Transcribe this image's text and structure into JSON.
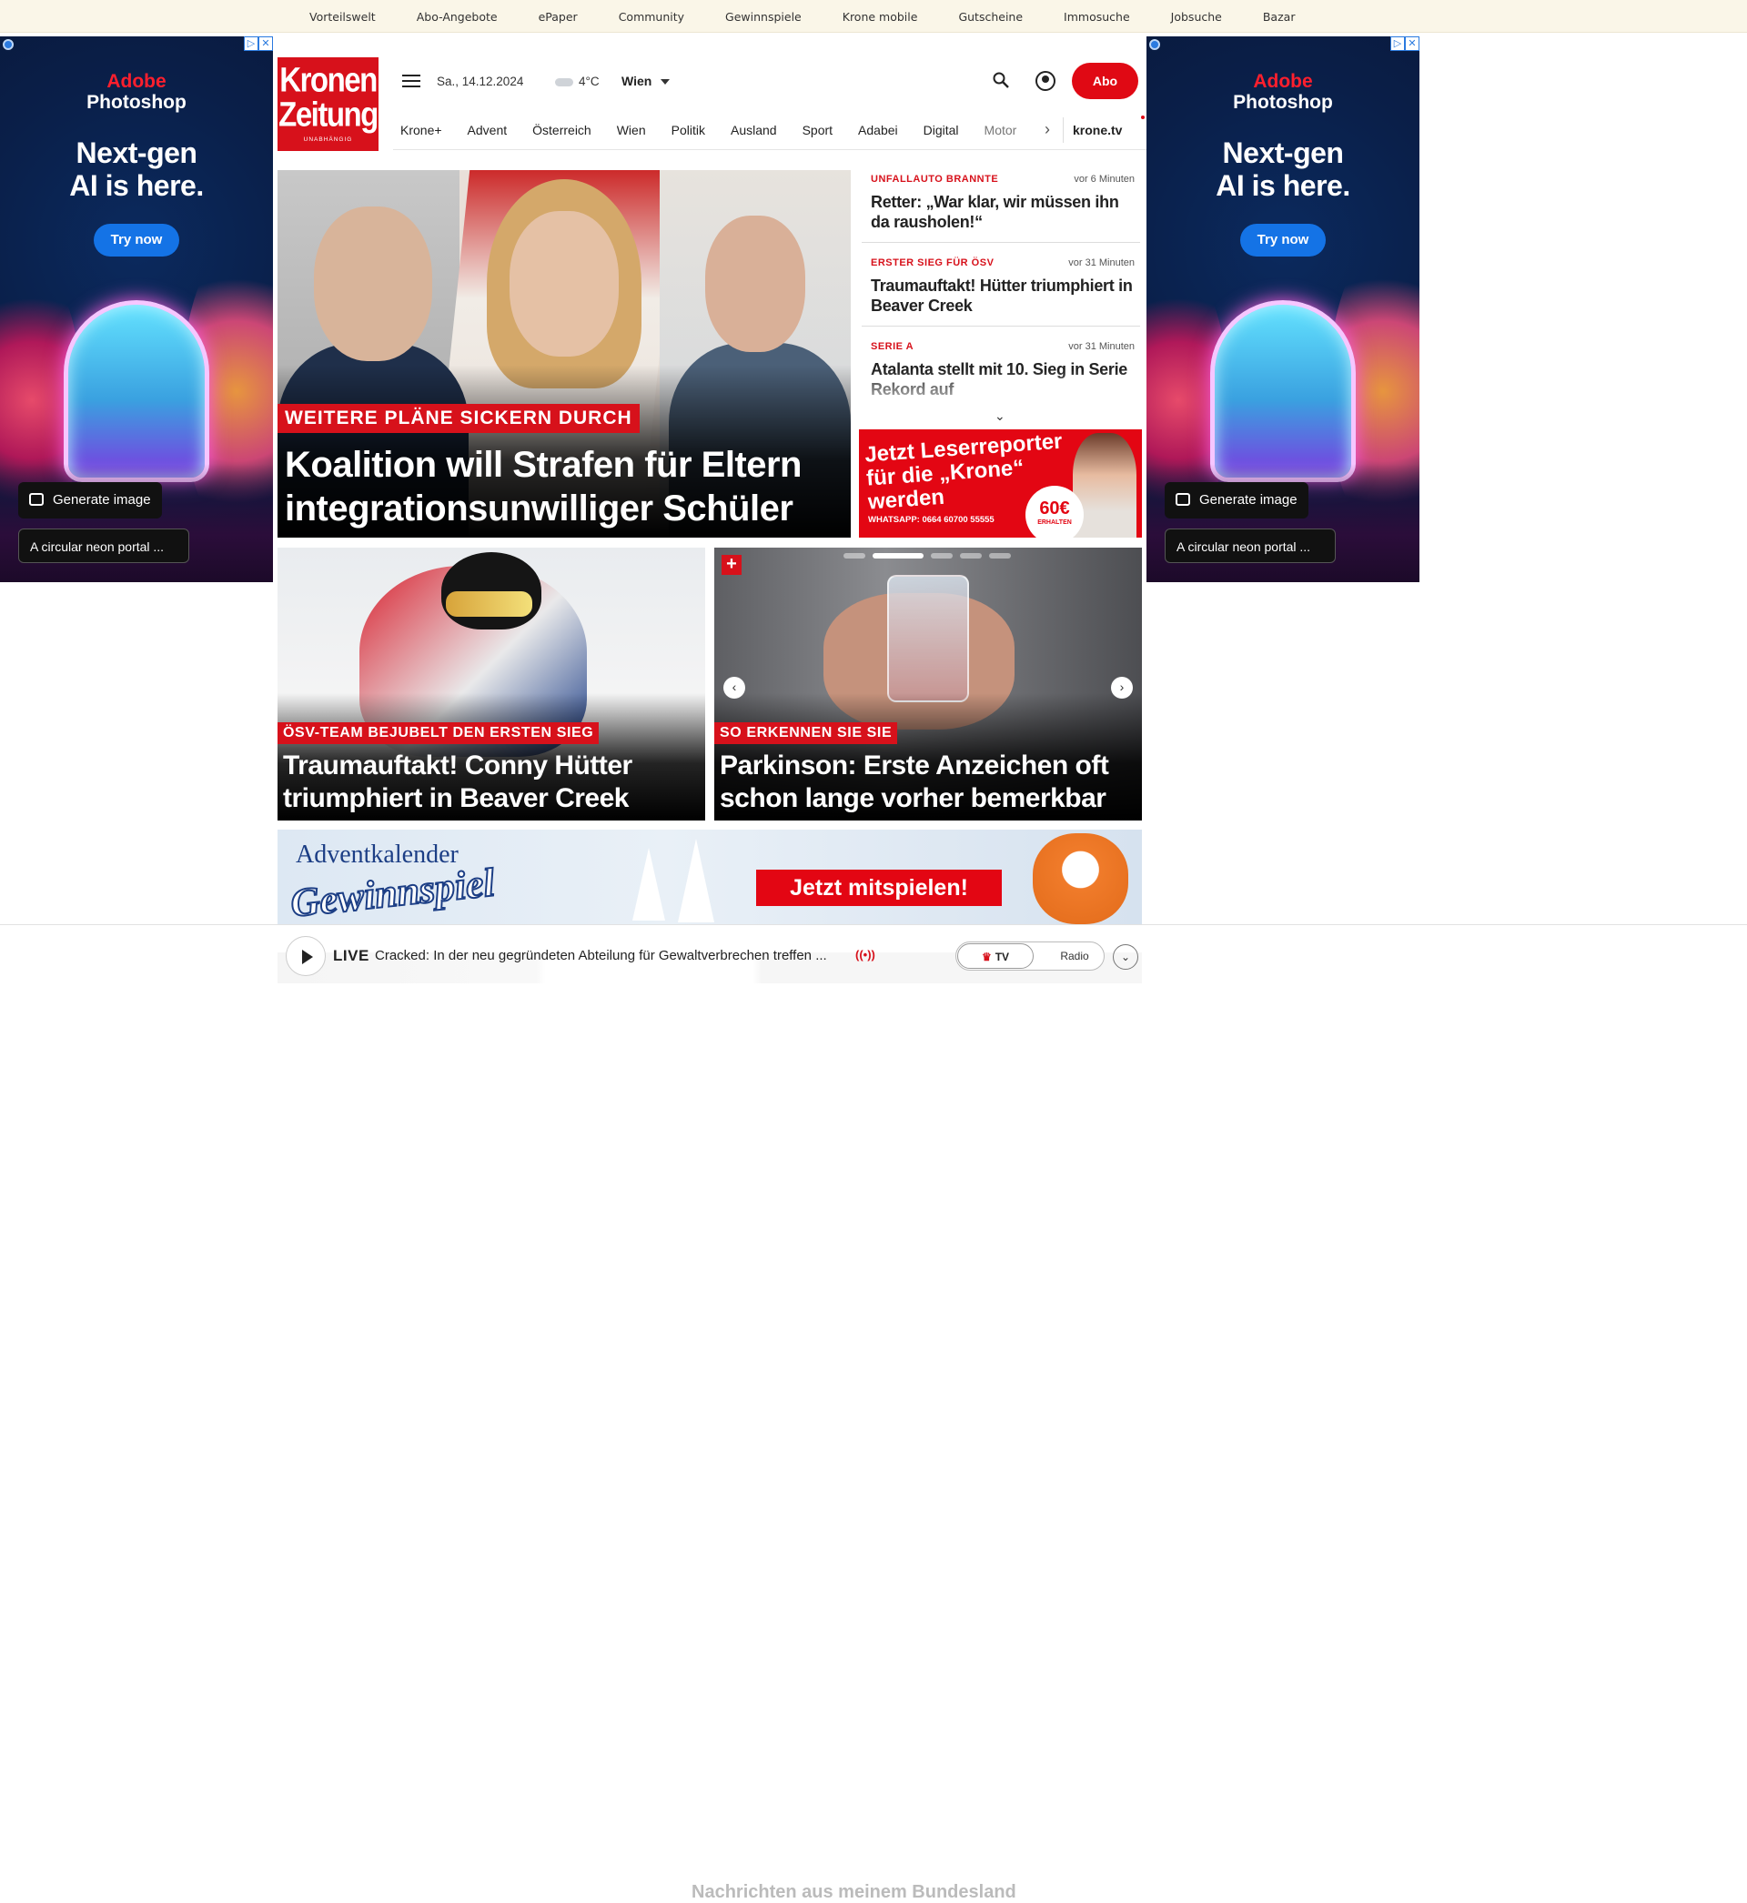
{
  "topbar": {
    "links": [
      "Vorteilswelt",
      "Abo-Angebote",
      "ePaper",
      "Community",
      "Gewinnspiele",
      "Krone mobile",
      "Gutscheine",
      "Immosuche",
      "Jobsuche",
      "Bazar"
    ]
  },
  "ad": {
    "brand_line1": "Adobe",
    "brand_line2": "Photoshop",
    "headline_line1": "Next-gen",
    "headline_line2": "AI is here.",
    "cta": "Try now",
    "generate_label": "Generate image",
    "prompt_text": "A circular neon portal ...",
    "adchoices_icons": [
      "play-icon",
      "close-icon"
    ]
  },
  "header": {
    "logo_line1": "Kronen",
    "logo_line2": "Zeitung",
    "logo_tagline": "UNABHÄNGIG",
    "date": "Sa., 14.12.2024",
    "temperature": "4°C",
    "city": "Wien",
    "abo_label": "Abo",
    "icons": [
      "menu-icon",
      "cloud-icon",
      "chevron-down-icon",
      "search-icon",
      "user-icon"
    ]
  },
  "nav": {
    "items": [
      "Krone+",
      "Advent",
      "Österreich",
      "Wien",
      "Politik",
      "Ausland",
      "Sport",
      "Adabei",
      "Digital",
      "Motor"
    ],
    "more_icon": "chevron-right-icon",
    "tv_link": "krone.tv"
  },
  "hero": {
    "kicker": "WEITERE PLÄNE SICKERN DURCH",
    "title": "Koalition will Strafen für Eltern integrationsunwilliger Schüler"
  },
  "ticker": {
    "items": [
      {
        "category": "UNFALLAUTO BRANNTE",
        "time": "vor 6 Minuten",
        "headline": "Retter: „War klar, wir müssen ihn da rausholen!“"
      },
      {
        "category": "ERSTER SIEG FÜR ÖSV",
        "time": "vor 31 Minuten",
        "headline": "Traumauftakt! Hütter triumphiert in Beaver Creek"
      },
      {
        "category": "SERIE A",
        "time": "vor 31 Minuten",
        "headline": "Atalanta stellt mit 10. Sieg in Serie Rekord auf"
      }
    ],
    "expand_icon": "chevron-down-icon"
  },
  "promo": {
    "title": "Jetzt Leserreporter für die „Krone“ werden",
    "whatsapp": "WHATSAPP: 0664 60700 55555",
    "badge_amount": "60€",
    "badge_text": "ERHALTEN"
  },
  "cards": [
    {
      "kicker": "ÖSV-TEAM BEJUBELT DEN ERSTEN SIEG",
      "title": "Traumauftakt! Conny Hütter triumphiert in Beaver Creek"
    },
    {
      "kicker": "SO ERKENNEN SIE SIE",
      "title": "Parkinson: Erste Anzeichen oft schon lange vorher bemerkbar",
      "plus": "+",
      "prev": "‹",
      "next": "›"
    }
  ],
  "advent_banner": {
    "line1": "Adventkalender",
    "line2": "Gewinnspiel",
    "cta": "Jetzt mitspielen!"
  },
  "player": {
    "live_label": "LIVE",
    "text": "Cracked: In der neu gegründeten Abteilung für Gewaltverbrechen treffen ...",
    "tv_label": "TV",
    "radio_label": "Radio",
    "expand": "⌄",
    "below_text": "Nachrichten aus meinem Bundesland"
  },
  "colors": {
    "brand_red": "#d7111b",
    "topbar_bg": "#faf6e8",
    "adobe_blue": "#1473e6"
  }
}
